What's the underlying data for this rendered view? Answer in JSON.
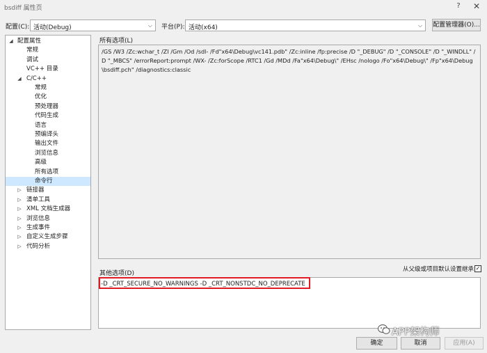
{
  "window": {
    "title": "bsdiff 属性页",
    "help": "?",
    "close": "✕"
  },
  "toolbar": {
    "config_label": "配置(C):",
    "config_value": "活动(Debug)",
    "platform_label": "平台(P):",
    "platform_value": "活动(x64)",
    "manager_button": "配置管理器(O)..."
  },
  "tree": [
    {
      "label": "配置属性",
      "expander": "◢"
    },
    {
      "label": "常规",
      "expander": ""
    },
    {
      "label": "调试",
      "expander": ""
    },
    {
      "label": "VC++ 目录",
      "expander": ""
    },
    {
      "label": "C/C++",
      "expander": "◢"
    },
    {
      "label": "常规",
      "expander": ""
    },
    {
      "label": "优化",
      "expander": ""
    },
    {
      "label": "预处理器",
      "expander": ""
    },
    {
      "label": "代码生成",
      "expander": ""
    },
    {
      "label": "语言",
      "expander": ""
    },
    {
      "label": "预编译头",
      "expander": ""
    },
    {
      "label": "输出文件",
      "expander": ""
    },
    {
      "label": "浏览信息",
      "expander": ""
    },
    {
      "label": "高级",
      "expander": ""
    },
    {
      "label": "所有选项",
      "expander": ""
    },
    {
      "label": "命令行",
      "expander": ""
    },
    {
      "label": "链接器",
      "expander": "▷"
    },
    {
      "label": "清单工具",
      "expander": "▷"
    },
    {
      "label": "XML 文档生成器",
      "expander": "▷"
    },
    {
      "label": "浏览信息",
      "expander": "▷"
    },
    {
      "label": "生成事件",
      "expander": "▷"
    },
    {
      "label": "自定义生成步骤",
      "expander": "▷"
    },
    {
      "label": "代码分析",
      "expander": "▷"
    }
  ],
  "all_options": {
    "title": "所有选项(L)",
    "text": "/GS /W3 /Zc:wchar_t /ZI /Gm /Od /sdl- /Fd\"x64\\Debug\\vc141.pdb\" /Zc:inline /fp:precise /D \"_DEBUG\" /D \"_CONSOLE\" /D \"_WINDLL\" /D \"_MBCS\" /errorReport:prompt /WX- /Zc:forScope /RTC1 /Gd /MDd /Fa\"x64\\Debug\\\" /EHsc /nologo /Fo\"x64\\Debug\\\" /Fp\"x64\\Debug\\bsdiff.pch\" /diagnostics:classic"
  },
  "other_options": {
    "title": "其他选项(D)",
    "inherit_label": "从父级或项目默认设置继承",
    "inherit_check": "✓",
    "value": "-D _CRT_SECURE_NO_WARNINGS -D _CRT_NONSTDC_NO_DEPRECATE"
  },
  "buttons": {
    "ok": "确定",
    "cancel": "取消",
    "apply": "应用(A)"
  },
  "watermark": "APP架构师",
  "colors": {
    "highlight": "#e01b24",
    "selected": "#cde8ff"
  }
}
